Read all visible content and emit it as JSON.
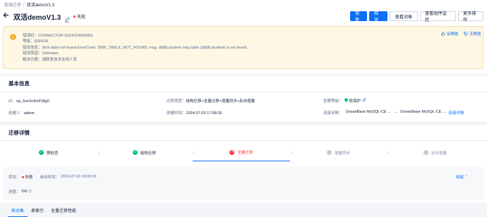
{
  "breadcrumb": {
    "parent": "数据迁移",
    "sep": "/",
    "current": "双活demoV1.3"
  },
  "header": {
    "title": "双活demoV1.3",
    "status": "失败",
    "buttons": {
      "resume": "恢 复",
      "release": "释 放",
      "view_objects": "查看对象",
      "view_monitor": "查看组件监控",
      "more": "更多操作"
    }
  },
  "alert": {
    "code": "错误码：CONNECTOR-SOOO04000001",
    "level": "等级：ERROR",
    "message": "错误信息：Sink table not found.ErrorCode: SINK_TABLE_NOT_FOUND; msg: db88.student map table (db88.student) is not found.",
    "cause": "错误原因：Unknown",
    "solution": "解决方案：请联系技术支持人员",
    "helpful": "有帮助",
    "unhelpful": "无帮助"
  },
  "basic_info": {
    "title": "基本信息",
    "id_label": "ID：",
    "id_value": "np_5ve3x3m918g0",
    "type_label": "迁移类型：",
    "type_value": "结构迁移+全量迁移+增量同步+反向增量",
    "alert_label": "告警等级：",
    "alert_value": "低保护",
    "creator_label": "创建人：",
    "creator_value": "admin",
    "created_label": "创建时间：",
    "created_value": "2024-07-03 17:58:26",
    "conn_label": "连接详情：",
    "conn_src": "OceanBase MySQL-CE ...",
    "conn_arrow": "→",
    "conn_dst": "OceanBase MySQL-CE ...",
    "conn_link": "连接详情"
  },
  "migration": {
    "title": "迁移详情",
    "steps": [
      {
        "label": "预检查",
        "state": "done"
      },
      {
        "label": "结构迁移",
        "state": "done"
      },
      {
        "label": "全量迁移",
        "state": "failed"
      },
      {
        "label": "增量同步",
        "state": "pending"
      },
      {
        "label": "反向增量",
        "state": "pending"
      }
    ],
    "status_label": "状态：",
    "status_value": "失败",
    "start_label": "启动时间：",
    "start_value": "2024-07-03 18:00:01",
    "collapse": "收起",
    "progress_label": "进度：",
    "progress_value": "0%"
  },
  "tabs": [
    "表对象",
    "表索引",
    "全量迁移性能"
  ],
  "colors": {
    "primary": "#0d6ef6",
    "success": "#0ac185",
    "error": "#f93939",
    "pending": "#c5ccd8"
  }
}
